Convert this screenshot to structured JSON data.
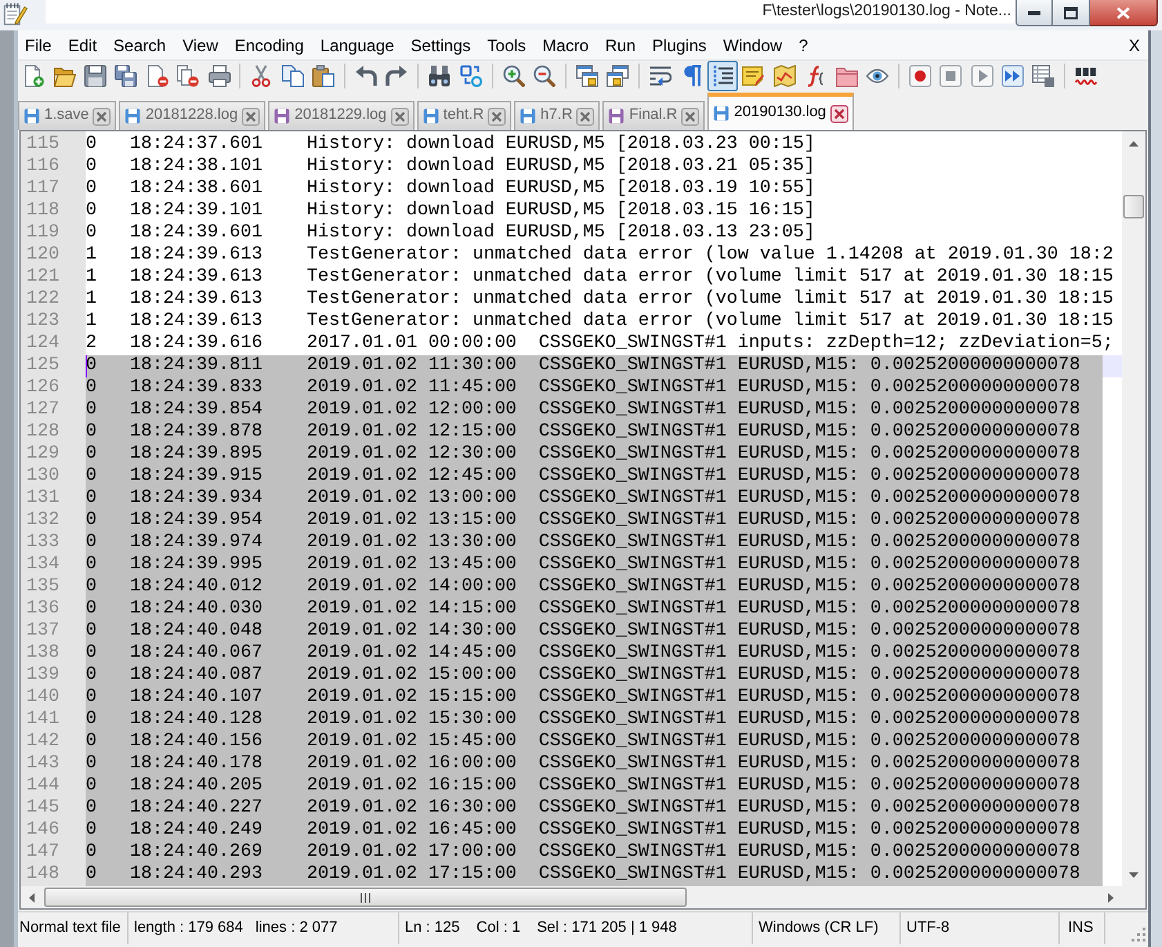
{
  "window": {
    "title": "F\\tester\\logs\\20190130.log - Note..."
  },
  "menu": [
    "File",
    "Edit",
    "Search",
    "View",
    "Encoding",
    "Language",
    "Settings",
    "Tools",
    "Macro",
    "Run",
    "Plugins",
    "Window",
    "?"
  ],
  "menu_close": "X",
  "toolbar": [
    [
      {
        "pressed": false
      },
      {
        "pressed": false
      },
      {
        "pressed": false
      },
      {
        "pressed": false
      },
      {
        "pressed": false
      },
      {
        "pressed": false
      },
      {
        "pressed": false
      }
    ],
    [
      {
        "pressed": false
      },
      {
        "pressed": false
      },
      {
        "pressed": false
      }
    ],
    [
      {
        "pressed": false
      },
      {
        "pressed": false
      }
    ],
    [
      {
        "pressed": false
      },
      {
        "pressed": false
      }
    ],
    [
      {
        "pressed": false
      },
      {
        "pressed": false
      }
    ],
    [
      {
        "pressed": false
      },
      {
        "pressed": false
      }
    ],
    [
      {
        "pressed": false
      },
      {
        "pressed": false
      },
      {
        "pressed": true
      },
      {
        "pressed": false
      },
      {
        "pressed": false
      },
      {
        "pressed": false
      },
      {
        "pressed": false
      },
      {
        "pressed": false
      }
    ],
    [
      {
        "pressed": false
      },
      {
        "pressed": false
      },
      {
        "pressed": false
      },
      {
        "pressed": false
      },
      {
        "pressed": false
      }
    ],
    [
      {
        "pressed": false
      }
    ]
  ],
  "tabs": [
    {
      "label": "1.save",
      "selected": false,
      "color": "#4a8fd8"
    },
    {
      "label": "20181228.log",
      "selected": false,
      "color": "#4a8fd8"
    },
    {
      "label": "20181229.log",
      "selected": false,
      "color": "#9467b0"
    },
    {
      "label": "teht.R",
      "selected": false,
      "color": "#4a8fd8"
    },
    {
      "label": "h7.R",
      "selected": false,
      "color": "#4a8fd8"
    },
    {
      "label": "Final.R",
      "selected": false,
      "color": "#9467b0"
    },
    {
      "label": "20190130.log",
      "selected": true,
      "color": "#4a8fd8"
    }
  ],
  "editor": {
    "lines": [
      {
        "number": "115",
        "text": "0\t18:24:37.601\tHistory: download EURUSD,M5 [2018.03.23 00:15]",
        "selected": false,
        "current": false
      },
      {
        "number": "116",
        "text": "0\t18:24:38.101\tHistory: download EURUSD,M5 [2018.03.21 05:35]",
        "selected": false,
        "current": false
      },
      {
        "number": "117",
        "text": "0\t18:24:38.601\tHistory: download EURUSD,M5 [2018.03.19 10:55]",
        "selected": false,
        "current": false
      },
      {
        "number": "118",
        "text": "0\t18:24:39.101\tHistory: download EURUSD,M5 [2018.03.15 16:15]",
        "selected": false,
        "current": false
      },
      {
        "number": "119",
        "text": "0\t18:24:39.601\tHistory: download EURUSD,M5 [2018.03.13 23:05]",
        "selected": false,
        "current": false
      },
      {
        "number": "120",
        "text": "1\t18:24:39.613\tTestGenerator: unmatched data error (low value 1.14208 at 2019.01.30 18:2",
        "selected": false,
        "current": false
      },
      {
        "number": "121",
        "text": "1\t18:24:39.613\tTestGenerator: unmatched data error (volume limit 517 at 2019.01.30 18:15",
        "selected": false,
        "current": false
      },
      {
        "number": "122",
        "text": "1\t18:24:39.613\tTestGenerator: unmatched data error (volume limit 517 at 2019.01.30 18:15",
        "selected": false,
        "current": false
      },
      {
        "number": "123",
        "text": "1\t18:24:39.613\tTestGenerator: unmatched data error (volume limit 517 at 2019.01.30 18:15",
        "selected": false,
        "current": false
      },
      {
        "number": "124",
        "text": "2\t18:24:39.616\t2017.01.01 00:00:00  CSSGEKO_SWINGST#1 inputs: zzDepth=12; zzDeviation=5;",
        "selected": false,
        "current": false
      },
      {
        "number": "125",
        "text": "0\t18:24:39.811\t2019.01.02 11:30:00  CSSGEKO_SWINGST#1 EURUSD,M15: 0.00252000000000078",
        "selected": true,
        "current": true
      },
      {
        "number": "126",
        "text": "0\t18:24:39.833\t2019.01.02 11:45:00  CSSGEKO_SWINGST#1 EURUSD,M15: 0.00252000000000078",
        "selected": true,
        "current": false
      },
      {
        "number": "127",
        "text": "0\t18:24:39.854\t2019.01.02 12:00:00  CSSGEKO_SWINGST#1 EURUSD,M15: 0.00252000000000078",
        "selected": true,
        "current": false
      },
      {
        "number": "128",
        "text": "0\t18:24:39.878\t2019.01.02 12:15:00  CSSGEKO_SWINGST#1 EURUSD,M15: 0.00252000000000078",
        "selected": true,
        "current": false
      },
      {
        "number": "129",
        "text": "0\t18:24:39.895\t2019.01.02 12:30:00  CSSGEKO_SWINGST#1 EURUSD,M15: 0.00252000000000078",
        "selected": true,
        "current": false
      },
      {
        "number": "130",
        "text": "0\t18:24:39.915\t2019.01.02 12:45:00  CSSGEKO_SWINGST#1 EURUSD,M15: 0.00252000000000078",
        "selected": true,
        "current": false
      },
      {
        "number": "131",
        "text": "0\t18:24:39.934\t2019.01.02 13:00:00  CSSGEKO_SWINGST#1 EURUSD,M15: 0.00252000000000078",
        "selected": true,
        "current": false
      },
      {
        "number": "132",
        "text": "0\t18:24:39.954\t2019.01.02 13:15:00  CSSGEKO_SWINGST#1 EURUSD,M15: 0.00252000000000078",
        "selected": true,
        "current": false
      },
      {
        "number": "133",
        "text": "0\t18:24:39.974\t2019.01.02 13:30:00  CSSGEKO_SWINGST#1 EURUSD,M15: 0.00252000000000078",
        "selected": true,
        "current": false
      },
      {
        "number": "134",
        "text": "0\t18:24:39.995\t2019.01.02 13:45:00  CSSGEKO_SWINGST#1 EURUSD,M15: 0.00252000000000078",
        "selected": true,
        "current": false
      },
      {
        "number": "135",
        "text": "0\t18:24:40.012\t2019.01.02 14:00:00  CSSGEKO_SWINGST#1 EURUSD,M15: 0.00252000000000078",
        "selected": true,
        "current": false
      },
      {
        "number": "136",
        "text": "0\t18:24:40.030\t2019.01.02 14:15:00  CSSGEKO_SWINGST#1 EURUSD,M15: 0.00252000000000078",
        "selected": true,
        "current": false
      },
      {
        "number": "137",
        "text": "0\t18:24:40.048\t2019.01.02 14:30:00  CSSGEKO_SWINGST#1 EURUSD,M15: 0.00252000000000078",
        "selected": true,
        "current": false
      },
      {
        "number": "138",
        "text": "0\t18:24:40.067\t2019.01.02 14:45:00  CSSGEKO_SWINGST#1 EURUSD,M15: 0.00252000000000078",
        "selected": true,
        "current": false
      },
      {
        "number": "139",
        "text": "0\t18:24:40.087\t2019.01.02 15:00:00  CSSGEKO_SWINGST#1 EURUSD,M15: 0.00252000000000078",
        "selected": true,
        "current": false
      },
      {
        "number": "140",
        "text": "0\t18:24:40.107\t2019.01.02 15:15:00  CSSGEKO_SWINGST#1 EURUSD,M15: 0.00252000000000078",
        "selected": true,
        "current": false
      },
      {
        "number": "141",
        "text": "0\t18:24:40.128\t2019.01.02 15:30:00  CSSGEKO_SWINGST#1 EURUSD,M15: 0.00252000000000078",
        "selected": true,
        "current": false
      },
      {
        "number": "142",
        "text": "0\t18:24:40.156\t2019.01.02 15:45:00  CSSGEKO_SWINGST#1 EURUSD,M15: 0.00252000000000078",
        "selected": true,
        "current": false
      },
      {
        "number": "143",
        "text": "0\t18:24:40.178\t2019.01.02 16:00:00  CSSGEKO_SWINGST#1 EURUSD,M15: 0.00252000000000078",
        "selected": true,
        "current": false
      },
      {
        "number": "144",
        "text": "0\t18:24:40.205\t2019.01.02 16:15:00  CSSGEKO_SWINGST#1 EURUSD,M15: 0.00252000000000078",
        "selected": true,
        "current": false
      },
      {
        "number": "145",
        "text": "0\t18:24:40.227\t2019.01.02 16:30:00  CSSGEKO_SWINGST#1 EURUSD,M15: 0.00252000000000078",
        "selected": true,
        "current": false
      },
      {
        "number": "146",
        "text": "0\t18:24:40.249\t2019.01.02 16:45:00  CSSGEKO_SWINGST#1 EURUSD,M15: 0.00252000000000078",
        "selected": true,
        "current": false
      },
      {
        "number": "147",
        "text": "0\t18:24:40.269\t2019.01.02 17:00:00  CSSGEKO_SWINGST#1 EURUSD,M15: 0.00252000000000078",
        "selected": true,
        "current": false
      },
      {
        "number": "148",
        "text": "0\t18:24:40.293\t2019.01.02 17:15:00  CSSGEKO_SWINGST#1 EURUSD,M15: 0.00252000000000078",
        "selected": true,
        "current": false
      }
    ]
  },
  "status_bar": [
    [
      "Normal text file"
    ],
    [
      "length : 179 684",
      "lines : 2 077"
    ],
    [
      "Ln : 125",
      "Col : 1",
      "Sel : 171 205 | 1 948"
    ],
    [
      "Windows (CR LF)"
    ],
    [
      "UTF-8"
    ],
    [
      "INS"
    ]
  ]
}
